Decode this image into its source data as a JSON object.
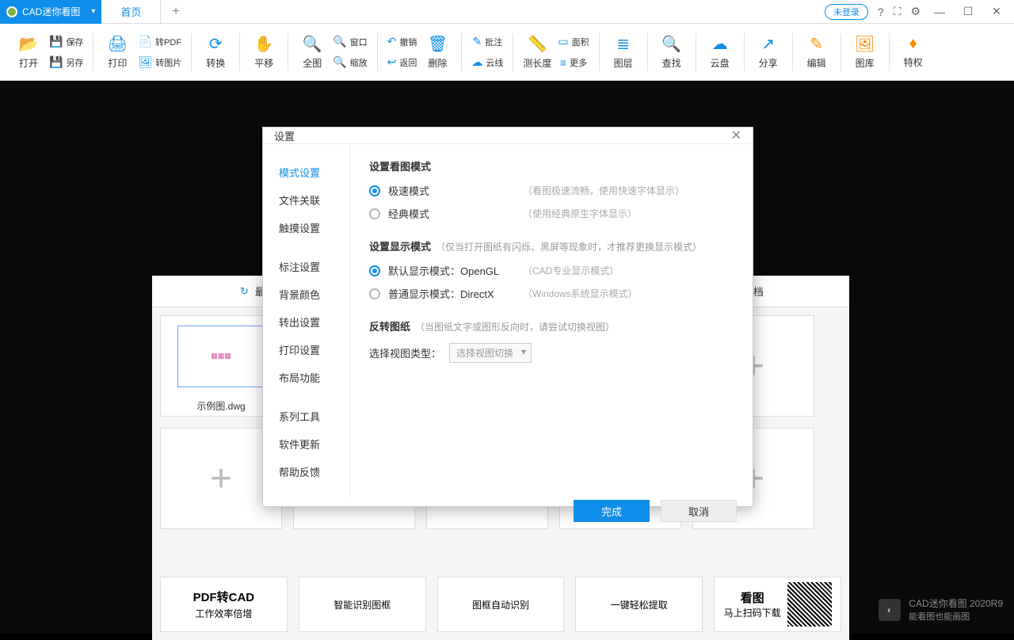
{
  "titlebar": {
    "app_name": "CAD迷你看图",
    "home_tab": "首页",
    "add_tab": "+",
    "login": "未登录"
  },
  "toolbar": {
    "open": "打开",
    "save": "保存",
    "saveas": "另存",
    "print": "打印",
    "topdf": "转PDF",
    "toimg": "转图片",
    "convert": "转换",
    "pan": "平移",
    "fit": "全图",
    "window": "窗口",
    "zoom": "缩放",
    "undo": "撤销",
    "back": "返回",
    "delete": "删除",
    "annotate": "批注",
    "cloud_line": "云线",
    "measure": "测长度",
    "area": "面积",
    "more": "更多",
    "layer": "图层",
    "find": "查找",
    "cloud": "云盘",
    "share": "分享",
    "edit": "编辑",
    "gallery": "图库",
    "vip": "特权"
  },
  "start": {
    "tab_recent": "最近打开",
    "tab_docs": "我的文档",
    "sample_file": "示例图.dwg",
    "promos": {
      "p1_title": "PDF转CAD",
      "p1_sub": "工作效率倍增",
      "p2_sub": "智能识别图框",
      "p3_sub": "图框自动识别",
      "p4_sub": "一键轻松提取",
      "p5_title": "看图",
      "p5_sub": "马上扫码下载"
    }
  },
  "dialog": {
    "title": "设置",
    "nav": {
      "mode": "模式设置",
      "assoc": "文件关联",
      "touch": "触摸设置",
      "annot": "标注设置",
      "bg": "背景颜色",
      "export": "转出设置",
      "print": "打印设置",
      "layout": "布局功能",
      "tools": "系列工具",
      "update": "软件更新",
      "help": "帮助反馈"
    },
    "sect1": {
      "title": "设置看图模式",
      "r1": "极速模式",
      "r1_hint": "（看图极速流畅，使用快速字体显示）",
      "r2": "经典模式",
      "r2_hint": "（使用经典原生字体显示）"
    },
    "sect2": {
      "title": "设置显示模式",
      "title_hint": "（仅当打开图纸有闪烁、黑屏等现象时，才推荐更换显示模式）",
      "r1": "默认显示模式：OpenGL",
      "r1_hint": "（CAD专业显示模式）",
      "r2": "普通显示模式：DirectX",
      "r2_hint": "（Windows系统显示模式）"
    },
    "sect3": {
      "title": "反转图纸",
      "title_hint": "（当图纸文字或图形反向时，请尝试切换视图）",
      "label": "选择视图类型：",
      "select": "选择视图切换"
    },
    "ok": "完成",
    "cancel": "取消"
  },
  "footer": {
    "name": "CAD迷你看图  2020R9",
    "slogan": "能看图也能画图"
  }
}
